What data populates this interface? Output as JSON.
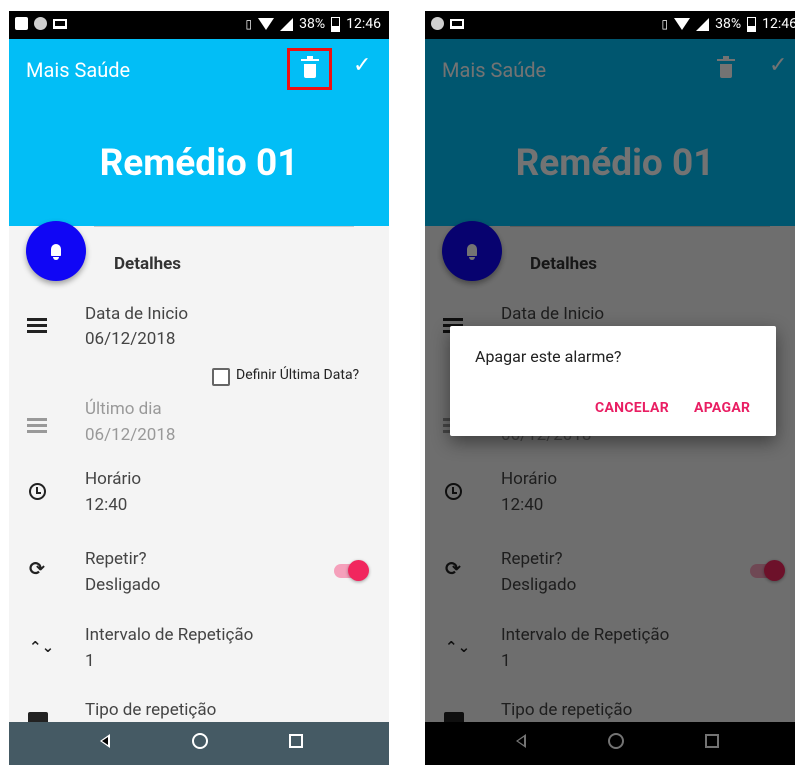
{
  "status_bar": {
    "battery": "38%",
    "time": "12:46"
  },
  "app_bar": {
    "title": "Mais Saúde"
  },
  "header": {
    "title": "Remédio 01"
  },
  "details": {
    "section_title": "Detalhes",
    "start_date": {
      "label": "Data de Inicio",
      "value": "06/12/2018"
    },
    "set_last_date": {
      "label": "Definir Última Data?",
      "checked": false
    },
    "last_day": {
      "label": "Último dia",
      "value": "06/12/2018"
    },
    "time": {
      "label": "Horário",
      "value": "12:40"
    },
    "repeat": {
      "label": "Repetir?",
      "value": "Desligado"
    },
    "interval": {
      "label": "Intervalo de Repetição",
      "value": "1"
    },
    "repeat_type": {
      "label": "Tipo de repetição"
    }
  },
  "dialog": {
    "message": "Apagar este alarme?",
    "cancel": "CANCELAR",
    "confirm": "APAGAR"
  },
  "colors": {
    "accent": "#02bef6",
    "fab": "#1006f5",
    "switch": "#f1265e",
    "dialog_buttons": "#e91e63",
    "highlight": "#ee1111"
  }
}
